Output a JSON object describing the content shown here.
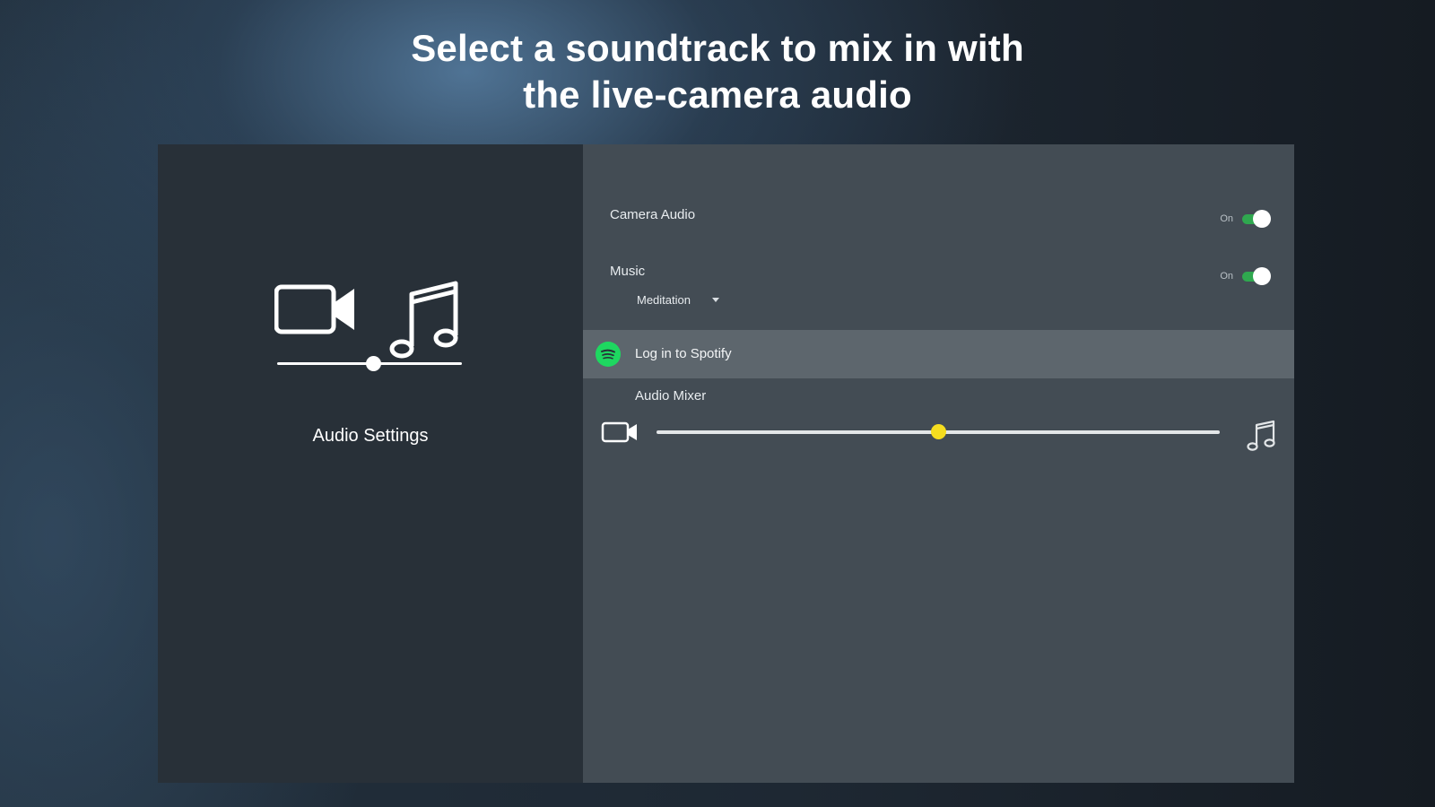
{
  "headline": {
    "line1": "Select a soundtrack to mix in with",
    "line2": "the live-camera audio"
  },
  "left_panel": {
    "icons": [
      "video-camera-icon",
      "music-note-icon"
    ],
    "balance_slider_fraction": 0.52,
    "caption": "Audio Settings"
  },
  "settings": {
    "camera_audio": {
      "label": "Camera Audio",
      "state_label": "On",
      "enabled": true
    },
    "music": {
      "label": "Music",
      "state_label": "On",
      "enabled": true,
      "selected_track": "Meditation"
    },
    "spotify": {
      "label": "Log in to Spotify",
      "icon": "spotify-icon",
      "color": "#1ed760"
    },
    "audio_mixer": {
      "label": "Audio Mixer",
      "slider_fraction": 0.5,
      "left_icon": "video-camera-icon",
      "right_icon": "music-note-icon",
      "knob_color": "#f5dd1f"
    }
  }
}
